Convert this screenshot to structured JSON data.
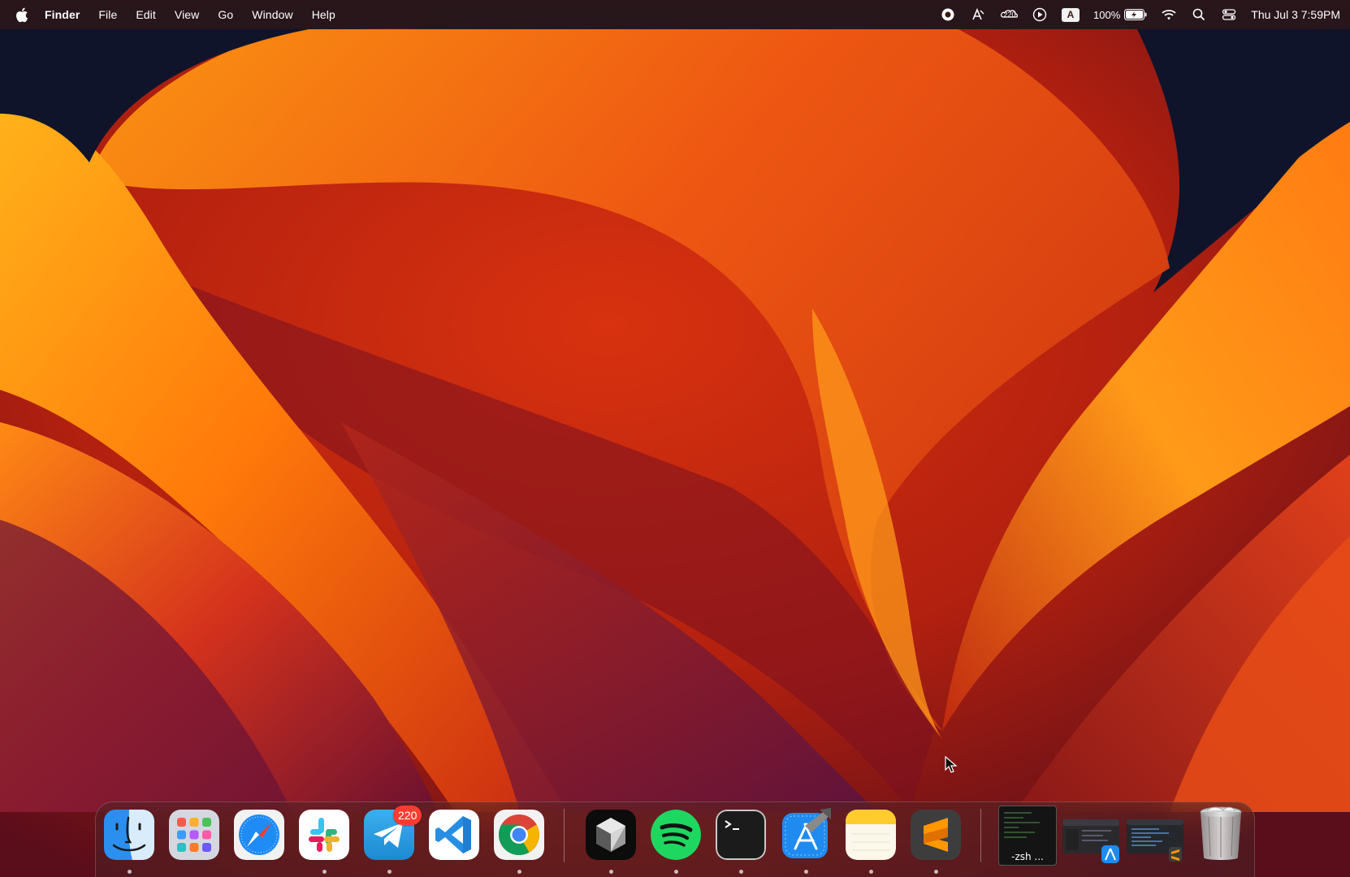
{
  "menubar": {
    "app_name": "Finder",
    "menus": [
      "File",
      "Edit",
      "View",
      "Go",
      "Window",
      "Help"
    ],
    "status_badge_count": "220",
    "keyboard_input": "A",
    "battery_percent": "100%",
    "clock": "Thu Jul 3  7:59PM"
  },
  "dock": {
    "apps": [
      {
        "name": "Finder",
        "icon": "finder-icon",
        "running": true
      },
      {
        "name": "Launchpad",
        "icon": "launchpad-icon",
        "running": false
      },
      {
        "name": "Safari",
        "icon": "safari-icon",
        "running": false
      },
      {
        "name": "Slack",
        "icon": "slack-icon",
        "running": true
      },
      {
        "name": "Telegram",
        "icon": "telegram-icon",
        "running": true,
        "badge": "220"
      },
      {
        "name": "Visual Studio Code",
        "icon": "vscode-icon",
        "running": false
      },
      {
        "name": "Google Chrome",
        "icon": "chrome-icon",
        "running": true
      },
      {
        "name": "Cursor",
        "icon": "cursor-cube-icon",
        "running": true
      },
      {
        "name": "Spotify",
        "icon": "spotify-icon",
        "running": true
      },
      {
        "name": "Terminal",
        "icon": "terminal-icon",
        "running": true
      },
      {
        "name": "Xcode",
        "icon": "xcode-icon",
        "running": true
      },
      {
        "name": "Notes",
        "icon": "notes-icon",
        "running": true
      },
      {
        "name": "Sublime Text",
        "icon": "sublime-icon",
        "running": true
      }
    ],
    "minimized_windows": [
      {
        "label": "-zsh ...",
        "icon": "terminal-window-icon"
      },
      {
        "label": "",
        "icon": "xcode-window-icon"
      },
      {
        "label": "",
        "icon": "sublime-window-icon"
      }
    ],
    "trash": {
      "icon": "trash-icon"
    }
  },
  "colors": {
    "wallpaper_orange": "#ff8a00",
    "wallpaper_red": "#c8200f",
    "wallpaper_dark": "#10142a",
    "badge_red": "#ff3b30"
  }
}
